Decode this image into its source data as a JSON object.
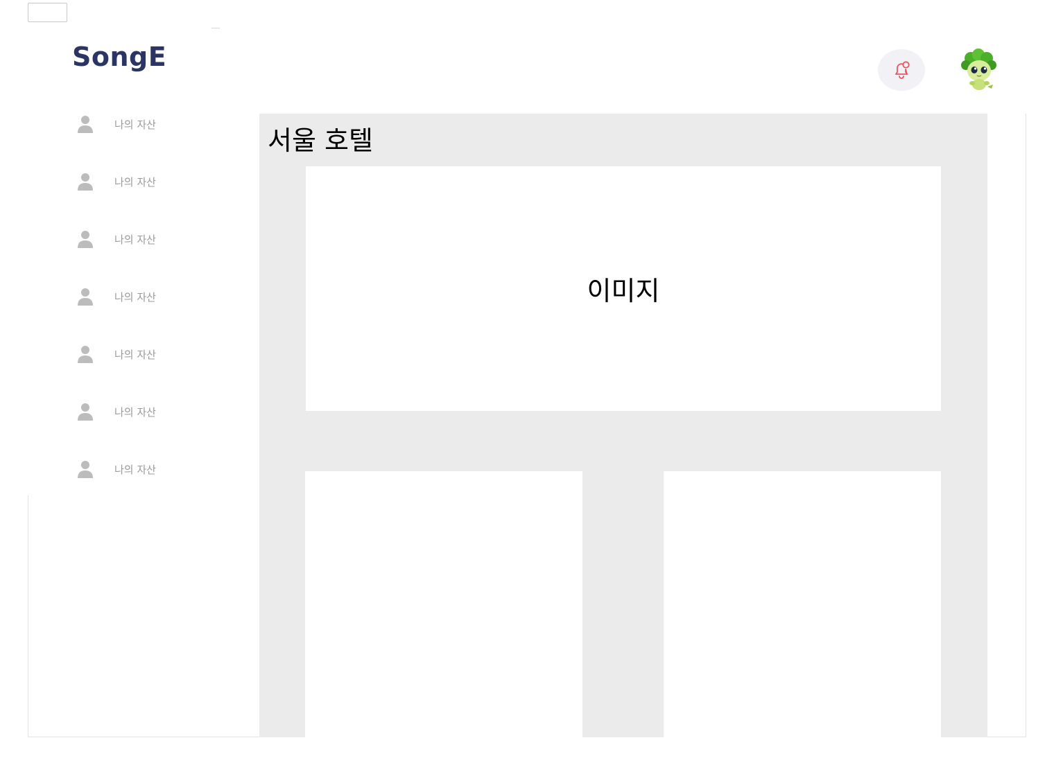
{
  "header": {
    "logo_text": "SongE",
    "bell_icon": "bell-icon",
    "avatar_icon": "mascot-avatar"
  },
  "sidebar": {
    "items": [
      {
        "label": "나의 자산",
        "icon": "user-icon"
      },
      {
        "label": "나의 자산",
        "icon": "user-icon"
      },
      {
        "label": "나의 자산",
        "icon": "user-icon"
      },
      {
        "label": "나의 자산",
        "icon": "user-icon"
      },
      {
        "label": "나의 자산",
        "icon": "user-icon"
      },
      {
        "label": "나의 자산",
        "icon": "user-icon"
      },
      {
        "label": "나의 자산",
        "icon": "user-icon"
      }
    ]
  },
  "main": {
    "title": "서울 호텔",
    "image_placeholder": "이미지"
  },
  "colors": {
    "brand": "#2b3565",
    "panel_bg": "#ebebeb",
    "bell_accent": "#f0525f",
    "sidebar_text": "#9a9a9a"
  }
}
